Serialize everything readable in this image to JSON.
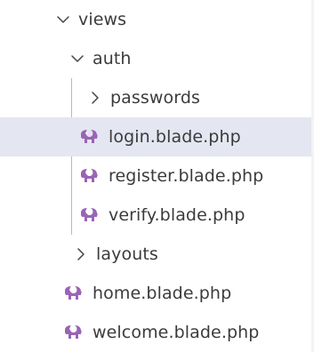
{
  "explorer": {
    "views": {
      "label": "views",
      "expanded": true
    },
    "auth": {
      "label": "auth",
      "expanded": true
    },
    "passwords": {
      "label": "passwords",
      "expanded": false
    },
    "auth_files": [
      {
        "label": "login.blade.php",
        "icon": "blade-elephant-icon",
        "selected": true
      },
      {
        "label": "register.blade.php",
        "icon": "blade-elephant-icon",
        "selected": false
      },
      {
        "label": "verify.blade.php",
        "icon": "blade-elephant-icon",
        "selected": false
      }
    ],
    "layouts": {
      "label": "layouts",
      "expanded": false
    },
    "view_files": [
      {
        "label": "home.blade.php",
        "icon": "blade-elephant-icon"
      },
      {
        "label": "welcome.blade.php",
        "icon": "blade-elephant-icon"
      }
    ]
  },
  "colors": {
    "selection_background": "#e4e6f1",
    "blade_icon": "#9b63b6",
    "text": "#3b3b3b",
    "indent_guide": "#b9b9b9"
  }
}
